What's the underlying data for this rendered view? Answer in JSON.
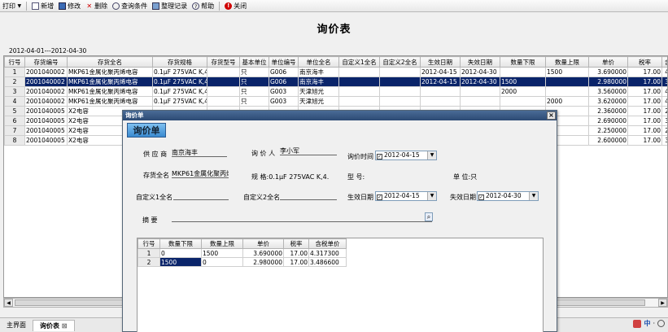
{
  "toolbar": {
    "print": "打印",
    "print_arrow": "▼",
    "new": "新增",
    "edit": "修改",
    "delete": "删除",
    "query": "查询条件",
    "organize": "整理记录",
    "help": "帮助",
    "close": "关闭"
  },
  "page_title": "询价表",
  "date_range": "2012-04-01---2012-04-30",
  "grid": {
    "columns": [
      "行号",
      "存货编号",
      "存货全名",
      "存货规格",
      "存货型号",
      "基本单位",
      "单位编号",
      "单位全名",
      "自定义1全名",
      "自定义2全名",
      "生效日期",
      "失效日期",
      "数量下限",
      "数量上限",
      "单价",
      "税率",
      "含税"
    ],
    "rows": [
      {
        "no": "1",
        "code": "2001040002",
        "name": "MKP61金属化聚丙烯电容",
        "spec": "0.1μF 275VAC K,4",
        "model": "",
        "unit": "只",
        "unit_code": "G006",
        "unit_name": "南京海丰",
        "c1": "",
        "c2": "",
        "start": "2012-04-15",
        "end": "2012-04-30",
        "qmin": "",
        "qmax": "1500",
        "price": "3.690000",
        "tax": "17.00",
        "taxp": "4.31"
      },
      {
        "no": "2",
        "code": "2001040002",
        "name": "MKP61金属化聚丙烯电容",
        "spec": "0.1μF 275VAC K,4",
        "model": "",
        "unit": "只",
        "unit_code": "G006",
        "unit_name": "南京海丰",
        "c1": "",
        "c2": "",
        "start": "2012-04-15",
        "end": "2012-04-30",
        "qmin": "1500",
        "qmax": "",
        "price": "2.980000",
        "tax": "17.00",
        "taxp": "3.48"
      },
      {
        "no": "3",
        "code": "2001040002",
        "name": "MKP61金属化聚丙烯电容",
        "spec": "0.1μF 275VAC K,4",
        "model": "",
        "unit": "只",
        "unit_code": "G003",
        "unit_name": "天津旭光",
        "c1": "",
        "c2": "",
        "start": "",
        "end": "",
        "qmin": "2000",
        "qmax": "",
        "price": "3.560000",
        "tax": "17.00",
        "taxp": "4.16"
      },
      {
        "no": "4",
        "code": "2001040002",
        "name": "MKP61金属化聚丙烯电容",
        "spec": "0.1μF 275VAC K,4",
        "model": "",
        "unit": "只",
        "unit_code": "G003",
        "unit_name": "天津旭光",
        "c1": "",
        "c2": "",
        "start": "",
        "end": "",
        "qmin": "",
        "qmax": "2000",
        "price": "3.620000",
        "tax": "17.00",
        "taxp": "4.23"
      },
      {
        "no": "5",
        "code": "2001040005",
        "name": "X2电容",
        "spec": "",
        "model": "",
        "unit": "",
        "unit_code": "",
        "unit_name": "",
        "c1": "",
        "c2": "",
        "start": "",
        "end": "",
        "qmin": "",
        "qmax": "",
        "price": "2.360000",
        "tax": "17.00",
        "taxp": "2.76"
      },
      {
        "no": "6",
        "code": "2001040005",
        "name": "X2电容",
        "spec": "",
        "model": "",
        "unit": "",
        "unit_code": "",
        "unit_name": "",
        "c1": "",
        "c2": "",
        "start": "",
        "end": "",
        "qmin": "",
        "qmax": "",
        "price": "2.690000",
        "tax": "17.00",
        "taxp": "3.14"
      },
      {
        "no": "7",
        "code": "2001040005",
        "name": "X2电容",
        "spec": "",
        "model": "",
        "unit": "",
        "unit_code": "",
        "unit_name": "",
        "c1": "",
        "c2": "",
        "start": "",
        "end": "",
        "qmin": "",
        "qmax": "",
        "price": "2.250000",
        "tax": "17.00",
        "taxp": "2.63"
      },
      {
        "no": "8",
        "code": "2001040005",
        "name": "X2电容",
        "spec": "",
        "model": "",
        "unit": "",
        "unit_code": "",
        "unit_name": "",
        "c1": "",
        "c2": "",
        "start": "",
        "end": "",
        "qmin": "",
        "qmax": "",
        "price": "2.600000",
        "tax": "17.00",
        "taxp": "3.04"
      }
    ]
  },
  "tabs": {
    "main": "主界面",
    "inquiry": "询价表",
    "close_glyph": "⊠"
  },
  "tray": {
    "ime": "中",
    "sep": "·"
  },
  "dialog": {
    "title": "询价单",
    "close_glyph": "×",
    "header": "询价单",
    "supplier_label": "供 应 商",
    "supplier_value": "南京海丰",
    "inquirer_label": "询 价 人",
    "inquirer_value": "李小军",
    "inquiry_time_label": "询价时间",
    "inquiry_time_value": "2012-04-15",
    "fullname_label": "存货全名",
    "fullname_value": "MKP61金属化聚丙烯E",
    "spec_label": "规    格:0.1μF 275VAC K,4.",
    "model_label": "型    号:",
    "unit_label": "单    位:只",
    "custom1_label": "自定义1全名",
    "custom2_label": "自定义2全名",
    "start_label": "生效日期",
    "start_value": "2012-04-15",
    "end_label": "失效日期",
    "end_value": "2012-04-30",
    "summary_label": "摘    要",
    "checked": "✓",
    "dropdown_arrow": "▼",
    "search_icon_glyph": "⌕",
    "sub_columns": [
      "行号",
      "数量下限",
      "数量上限",
      "单价",
      "税率",
      "含税单价"
    ],
    "sub_rows": [
      {
        "no": "1",
        "qmin": "0",
        "qmax": "1500",
        "price": "3.690000",
        "tax": "17.00",
        "taxp": "4.317300"
      },
      {
        "no": "2",
        "qmin": "1500",
        "qmax": "0",
        "price": "2.980000",
        "tax": "17.00",
        "taxp": "3.486600"
      }
    ]
  },
  "colors": {
    "selection": "#0a246a",
    "title_bar": "#2c4a74",
    "header_badge": "#3a8ad0",
    "close_icon": "#d00000"
  }
}
